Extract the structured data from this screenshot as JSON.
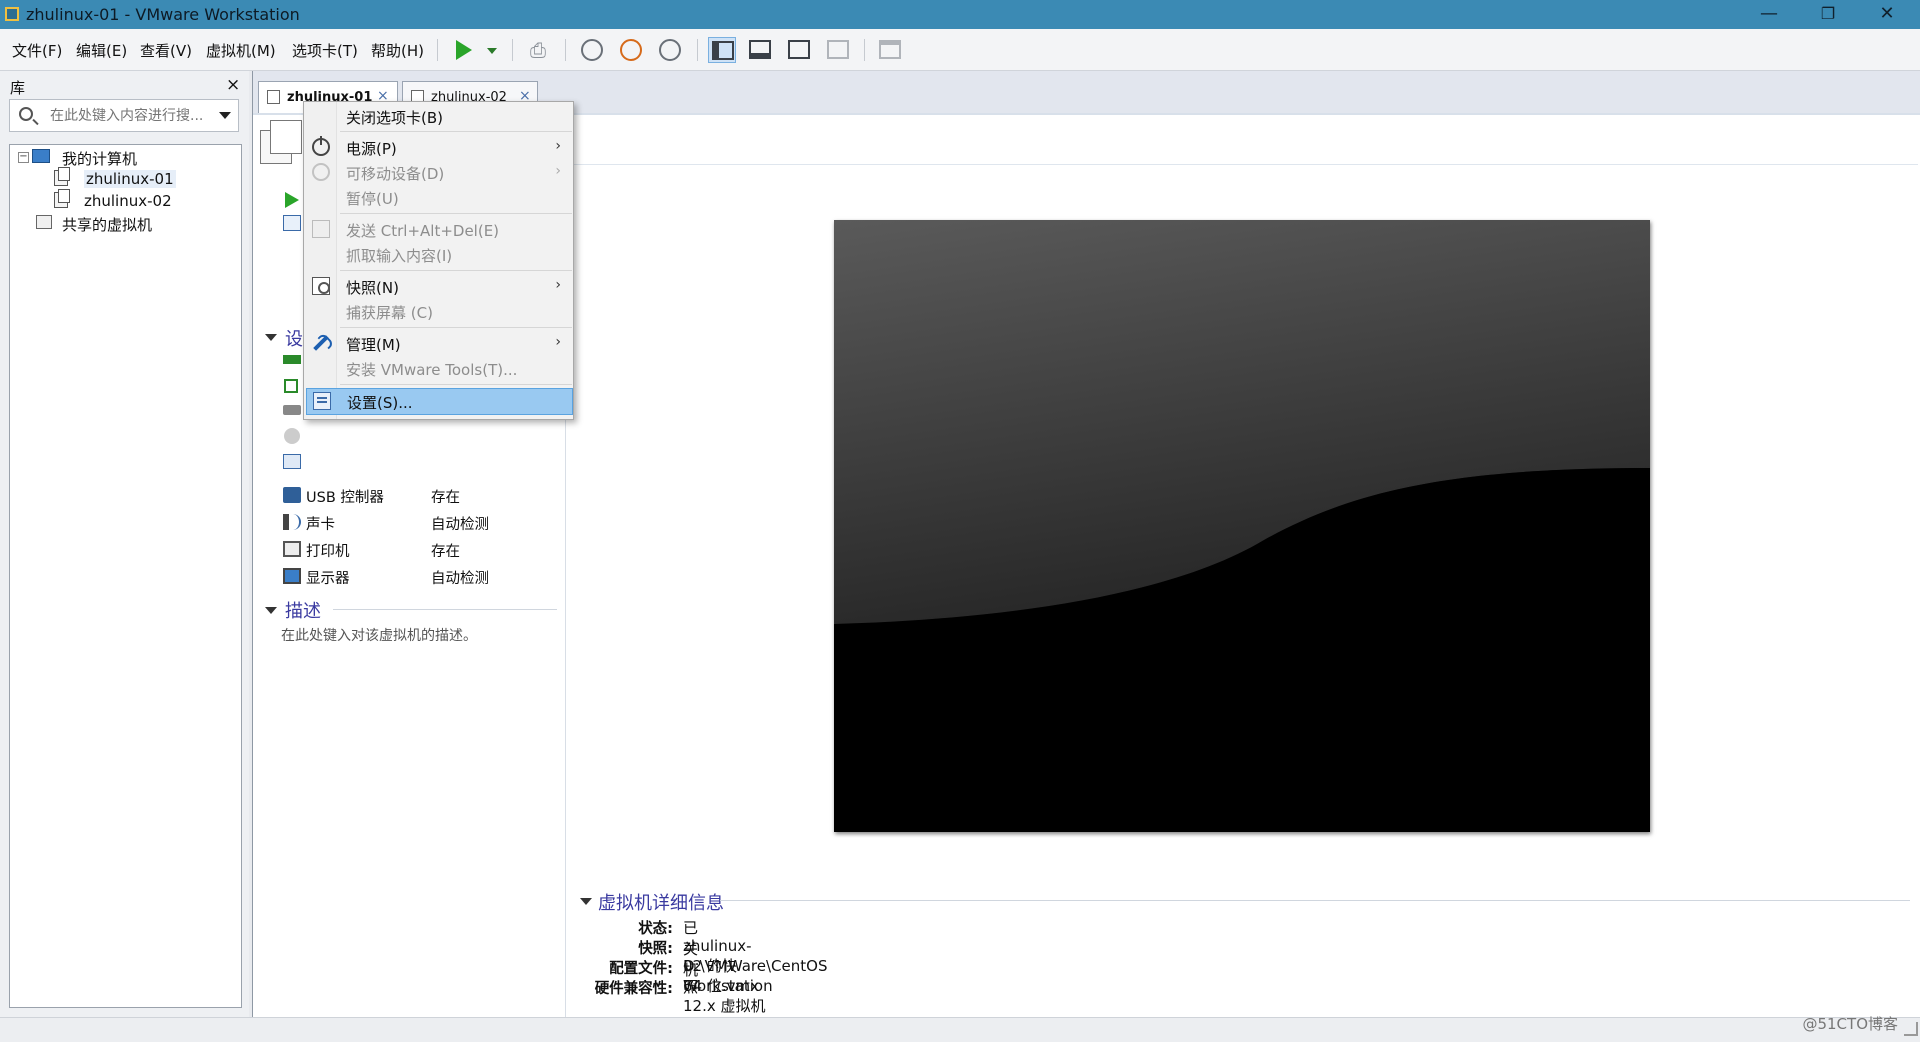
{
  "window": {
    "title": "zhulinux-01 - VMware Workstation",
    "minimize": "—",
    "restore": "❐",
    "close": "✕"
  },
  "menubar": {
    "file": "文件(F)",
    "edit": "编辑(E)",
    "view": "查看(V)",
    "vm": "虚拟机(M)",
    "tabs": "选项卡(T)",
    "help": "帮助(H)"
  },
  "toolbar": {
    "icons": [
      "play-icon",
      "play-dropdown-icon",
      "send-ctrl-alt-del-icon",
      "snapshot-take-icon",
      "snapshot-revert-icon",
      "snapshot-manager-icon",
      "library-view-icon",
      "console-view-icon",
      "fullscreen-icon",
      "unity-icon",
      "thumbnail-bar-icon"
    ]
  },
  "library": {
    "header": "库",
    "close": "×",
    "search_placeholder": "在此处键入内容进行搜...",
    "tree": {
      "root": "我的计算机",
      "expander": "−",
      "vms": [
        "zhulinux-01",
        "zhulinux-02"
      ],
      "shared": "共享的虚拟机"
    }
  },
  "tabs": [
    {
      "label": "zhulinux-01",
      "close": "×",
      "active": true
    },
    {
      "label": "zhulinux-02",
      "close": "×",
      "active": false
    }
  ],
  "vm_page": {
    "devices_title": "设",
    "devices": [
      {
        "icon": "usb-icon",
        "name": "USB 控制器",
        "value": "存在"
      },
      {
        "icon": "sound-card-icon",
        "name": "声卡",
        "value": "自动检测"
      },
      {
        "icon": "printer-icon",
        "name": "打印机",
        "value": "存在"
      },
      {
        "icon": "display-icon",
        "name": "显示器",
        "value": "自动检测"
      }
    ],
    "description_title": "描述",
    "description_placeholder": "在此处键入对该虚拟机的描述。"
  },
  "details": {
    "title": "虚拟机详细信息",
    "rows": [
      {
        "key": "状态:",
        "value": "已关机"
      },
      {
        "key": "快照:",
        "value": "zhulinux-02 的快照"
      },
      {
        "key": "配置文件:",
        "value": "D:\\VMWare\\CentOS 64 位.vmx"
      },
      {
        "key": "硬件兼容性:",
        "value": "Workstation 12.x 虚拟机"
      }
    ]
  },
  "context_menu": {
    "items": [
      {
        "label": "关闭选项卡(B)",
        "enabled": true,
        "submenu": false,
        "icon": ""
      },
      {
        "label": "电源(P)",
        "enabled": true,
        "submenu": true,
        "icon": "power-icon"
      },
      {
        "label": "可移动设备(D)",
        "enabled": false,
        "submenu": true,
        "icon": "disc-icon"
      },
      {
        "label": "暂停(U)",
        "enabled": false,
        "submenu": false,
        "icon": ""
      },
      {
        "label": "发送 Ctrl+Alt+Del(E)",
        "enabled": false,
        "submenu": false,
        "icon": "keyboard-icon"
      },
      {
        "label": "抓取输入内容(I)",
        "enabled": false,
        "submenu": false,
        "icon": ""
      },
      {
        "label": "快照(N)",
        "enabled": true,
        "submenu": true,
        "icon": "snapshot-icon"
      },
      {
        "label": "捕获屏幕 (C)",
        "enabled": false,
        "submenu": false,
        "icon": ""
      },
      {
        "label": "管理(M)",
        "enabled": true,
        "submenu": true,
        "icon": "wrench-icon"
      },
      {
        "label": "安装 VMware Tools(T)...",
        "enabled": false,
        "submenu": false,
        "icon": ""
      },
      {
        "label": "设置(S)...",
        "enabled": true,
        "submenu": false,
        "icon": "settings-icon",
        "highlighted": true
      }
    ],
    "arrow": "›"
  },
  "watermark": "@51CTO博客",
  "colors": {
    "titlebar": "#3b8ab4",
    "highlight": "#99c9f1",
    "section_title": "#3a3aa0",
    "play_green": "#2aa52a"
  }
}
